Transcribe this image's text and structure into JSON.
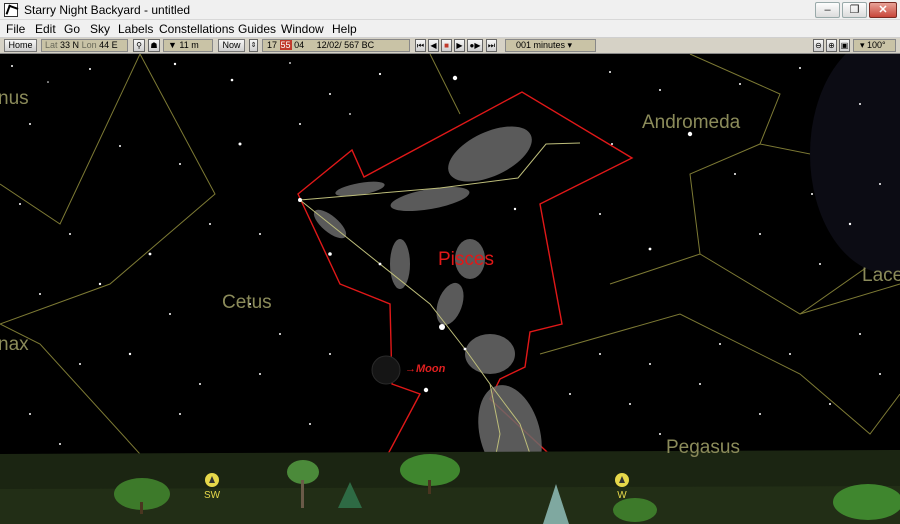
{
  "window": {
    "title": "Starry Night Backyard - untitled"
  },
  "menu": [
    "File",
    "Edit",
    "Go",
    "Sky",
    "Labels",
    "Constellations",
    "Guides",
    "Window",
    "Help"
  ],
  "toolbar": {
    "home": "Home",
    "lat_label": "Lat",
    "lat_value": "33 N",
    "lon_label": "Lon",
    "lon_value": "44 E",
    "elevation": "▼ 11 m",
    "now": "Now",
    "time_hour": "17",
    "time_min": "55",
    "time_sec": "04",
    "date": "12/02/  567 BC",
    "step": "001 minutes ▾",
    "fov": "▾ 100°"
  },
  "sky": {
    "constellations": [
      "Andromeda",
      "Pisces",
      "Cetus",
      "Pegasus",
      "Lace",
      "nus",
      "nax"
    ],
    "moon_label": "→Moon",
    "directions": [
      "SW",
      "W"
    ]
  },
  "colors": {
    "sky": "#000000",
    "constellation_label": "#8b8b5a",
    "boundary_selected": "#e01818",
    "boundary_line": "#8b8b3a",
    "horizon": "#1a2410",
    "direction_marker": "#e6d84a"
  }
}
